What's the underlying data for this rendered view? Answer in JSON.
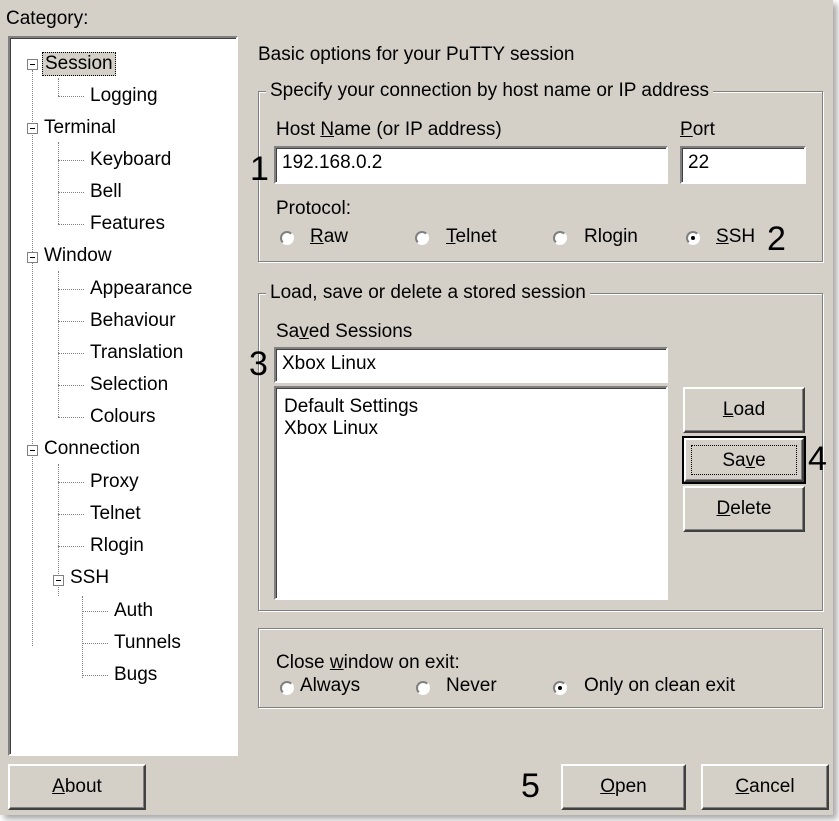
{
  "category_label": "Category:",
  "tree": [
    {
      "label": "Session",
      "selected": true
    },
    {
      "label": "Logging"
    },
    {
      "label": "Terminal"
    },
    {
      "label": "Keyboard"
    },
    {
      "label": "Bell"
    },
    {
      "label": "Features"
    },
    {
      "label": "Window"
    },
    {
      "label": "Appearance"
    },
    {
      "label": "Behaviour"
    },
    {
      "label": "Translation"
    },
    {
      "label": "Selection"
    },
    {
      "label": "Colours"
    },
    {
      "label": "Connection"
    },
    {
      "label": "Proxy"
    },
    {
      "label": "Telnet"
    },
    {
      "label": "Rlogin"
    },
    {
      "label": "SSH"
    },
    {
      "label": "Auth"
    },
    {
      "label": "Tunnels"
    },
    {
      "label": "Bugs"
    }
  ],
  "panel_title": "Basic options for your PuTTY session",
  "connection_group": {
    "legend": "Specify your connection by host name or IP address",
    "host_label_pre": "Host ",
    "host_label_u": "N",
    "host_label_post": "ame (or IP address)",
    "host_value": "192.168.0.2",
    "port_label_u": "P",
    "port_label_post": "ort",
    "port_value": "22",
    "protocol_label": "Protocol:",
    "protocols": [
      {
        "u": "R",
        "rest": "aw",
        "selected": false
      },
      {
        "u": "T",
        "rest": "elnet",
        "selected": false
      },
      {
        "u": "",
        "rest": "Rlogin",
        "selected": false
      },
      {
        "u": "S",
        "rest": "SH",
        "selected": true
      }
    ]
  },
  "session_group": {
    "legend": "Load, save or delete a stored session",
    "saved_label_pre": "Sa",
    "saved_label_u": "v",
    "saved_label_post": "ed Sessions",
    "saved_value": "Xbox Linux",
    "sessions": [
      "Default Settings",
      "Xbox Linux"
    ],
    "load_u": "L",
    "load_rest": "oad",
    "save_pre": "Sa",
    "save_u": "v",
    "save_rest": "e",
    "delete_u": "D",
    "delete_rest": "elete"
  },
  "close_group": {
    "label_pre": "Close ",
    "label_u": "w",
    "label_post": "indow on exit:",
    "options": [
      {
        "label": "Always",
        "selected": false
      },
      {
        "label": "Never",
        "selected": false
      },
      {
        "label": "Only on clean exit",
        "selected": true
      }
    ]
  },
  "bottom": {
    "about_u": "A",
    "about_rest": "bout",
    "open_u": "O",
    "open_rest": "pen",
    "cancel_u": "C",
    "cancel_rest": "ancel"
  },
  "step_numbers": [
    "1",
    "2",
    "3",
    "4",
    "5"
  ]
}
